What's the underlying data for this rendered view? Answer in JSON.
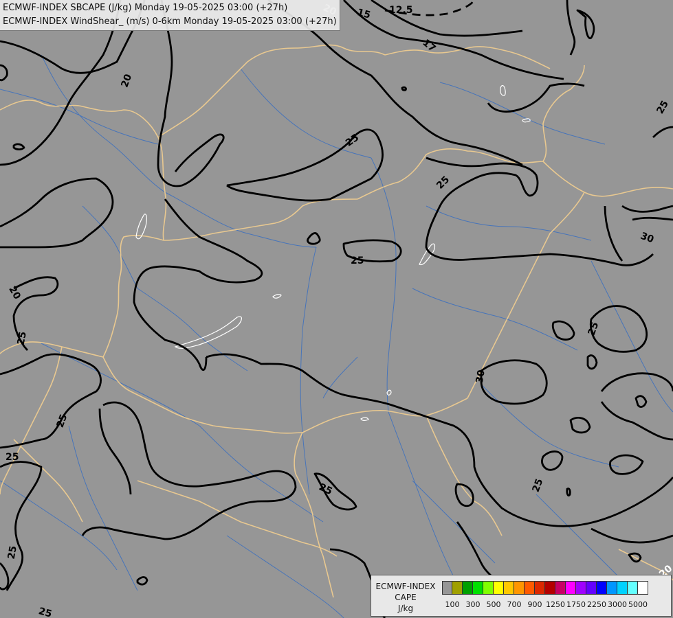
{
  "title": {
    "line1": "ECMWF-INDEX SBCAPE (J/kg) Monday 19-05-2025 03:00 (+27h)",
    "line2": "ECMWF-INDEX WindShear_ (m/s) 0-6km Monday 19-05-2025 03:00 (+27h)"
  },
  "legend": {
    "model": "ECMWF-INDEX",
    "param": "CAPE",
    "unit": "J/kg",
    "colors": [
      "#969696",
      "#a0a000",
      "#00a000",
      "#00e000",
      "#80ff00",
      "#ffff00",
      "#ffc800",
      "#ff9600",
      "#ff5a00",
      "#dc2800",
      "#b40000",
      "#c80064",
      "#ff00ff",
      "#a000ff",
      "#6400ff",
      "#0000ff",
      "#0096ff",
      "#00d2ff",
      "#64ffff",
      "#ffffff"
    ],
    "tick_labels": [
      "100",
      "300",
      "500",
      "700",
      "900",
      "1250",
      "1750",
      "2250",
      "3000",
      "5000"
    ]
  },
  "contour_labels": [
    {
      "id": "c20a",
      "text": "20"
    },
    {
      "id": "c15",
      "text": "15"
    },
    {
      "id": "c125",
      "text": "12.5"
    },
    {
      "id": "c17",
      "text": "17"
    },
    {
      "id": "c20b",
      "text": "20"
    },
    {
      "id": "c25a",
      "text": "25"
    },
    {
      "id": "c25b",
      "text": "25"
    },
    {
      "id": "c25c",
      "text": "25"
    },
    {
      "id": "c25d",
      "text": "25"
    },
    {
      "id": "c30a",
      "text": "30"
    },
    {
      "id": "c20c",
      "text": "20"
    },
    {
      "id": "c25e",
      "text": "25"
    },
    {
      "id": "c25f",
      "text": "25"
    },
    {
      "id": "c30b",
      "text": "30"
    },
    {
      "id": "c25g",
      "text": "25"
    },
    {
      "id": "c25h",
      "text": "25"
    },
    {
      "id": "c25i",
      "text": "25"
    },
    {
      "id": "c25j",
      "text": "25"
    },
    {
      "id": "c25k",
      "text": "25"
    },
    {
      "id": "c20d",
      "text": "20"
    },
    {
      "id": "c25l",
      "text": "25"
    }
  ]
}
